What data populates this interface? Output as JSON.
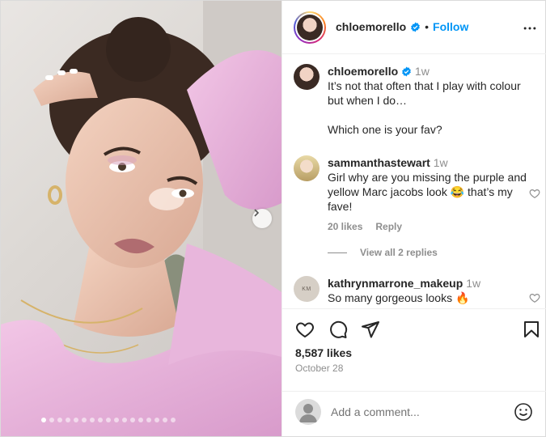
{
  "post": {
    "author": "chloemorello",
    "follow_label": "Follow",
    "header_separator": "•",
    "likes": "8,587 likes",
    "date": "October 28",
    "carousel": {
      "slide_count": 17,
      "active_index": 0
    }
  },
  "caption": {
    "username": "chloemorello",
    "time": "1w",
    "line1": "It’s not that often that I play with colour but when I do…",
    "line2": "Which one is your fav?"
  },
  "comments": [
    {
      "username": "sammanthastewart",
      "time": "1w",
      "text": "Girl why are you missing the purple and yellow Marc jacobs look 😂 that’s my fave!",
      "likes": "20 likes",
      "reply_label": "Reply"
    },
    {
      "username": "kathrynmarrone_makeup",
      "time": "1w",
      "text": "So many gorgeous looks 🔥",
      "avatar_text": "KM"
    }
  ],
  "view_replies": "View all 2 replies",
  "add_comment": {
    "placeholder": "Add a comment..."
  },
  "colors": {
    "follow_blue": "#0095f6",
    "verified_blue": "#0095f6",
    "muted_gray": "#8e8e8e"
  },
  "icons": [
    "heart-icon",
    "comment-icon",
    "share-icon",
    "bookmark-icon",
    "more-icon",
    "emoji-icon",
    "verified-icon",
    "chevron-right-icon"
  ]
}
